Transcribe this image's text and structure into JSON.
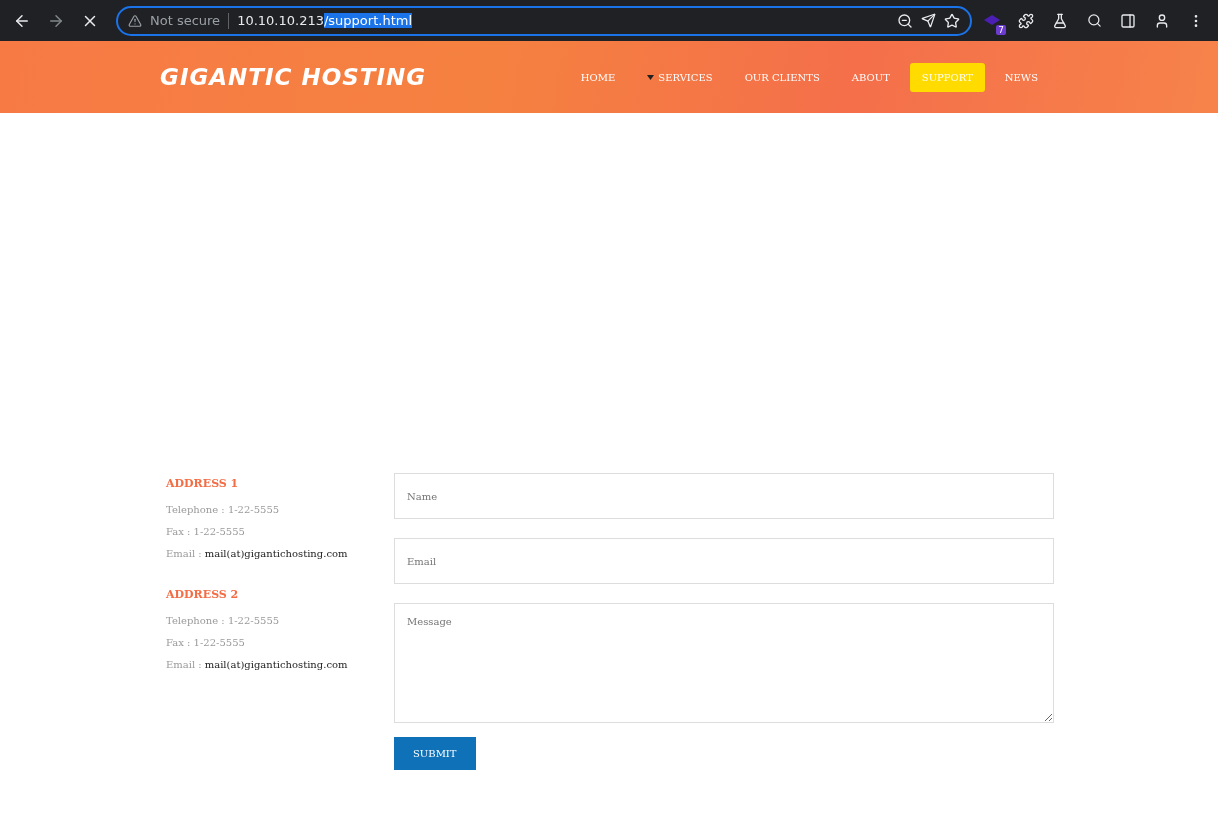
{
  "browser": {
    "security": "Not secure",
    "url_host": "10.10.10.213",
    "url_path": "/support.html",
    "extension_badge": "7"
  },
  "site": {
    "logo": "GIGANTIC HOSTING",
    "nav": [
      {
        "label": "HOME",
        "selected": false,
        "has_dropdown": false
      },
      {
        "label": "SERVICES",
        "selected": false,
        "has_dropdown": true
      },
      {
        "label": "OUR CLIENTS",
        "selected": false,
        "has_dropdown": false
      },
      {
        "label": "ABOUT",
        "selected": false,
        "has_dropdown": false
      },
      {
        "label": "SUPPORT",
        "selected": true,
        "has_dropdown": false
      },
      {
        "label": "NEWS",
        "selected": false,
        "has_dropdown": false
      }
    ]
  },
  "addresses": [
    {
      "title": "ADDRESS 1",
      "telephone": "Telephone : 1-22-5555",
      "fax": "Fax : 1-22-5555",
      "email_label": "Email :",
      "email": "mail(at)gigantichosting.com"
    },
    {
      "title": "ADDRESS 2",
      "telephone": "Telephone : 1-22-5555",
      "fax": "Fax : 1-22-5555",
      "email_label": "Email :",
      "email": "mail(at)gigantichosting.com"
    }
  ],
  "form": {
    "fields": [
      {
        "kind": "input",
        "placeholder": "Name"
      },
      {
        "kind": "input",
        "placeholder": "Email"
      },
      {
        "kind": "textarea",
        "placeholder": "Message"
      }
    ],
    "submit": "SUBMIT"
  }
}
